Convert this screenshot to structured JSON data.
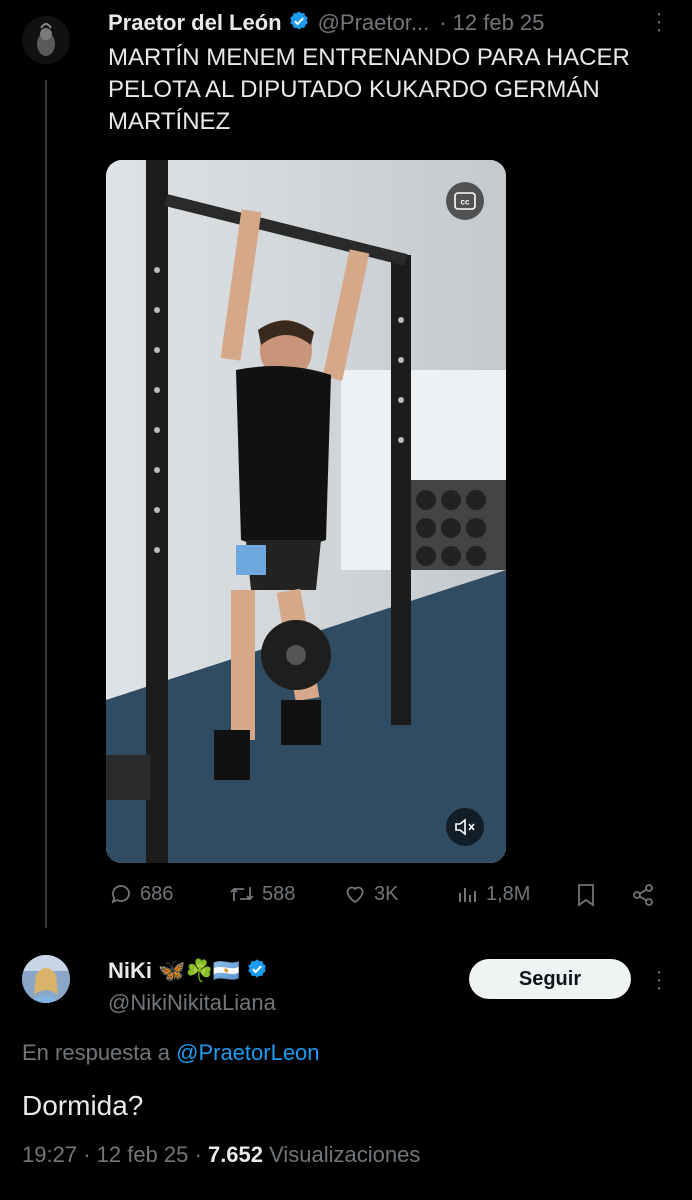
{
  "main_tweet": {
    "author_name": "Praetor del León",
    "handle": "@Praetor...",
    "date": "· 12 feb 25",
    "text": "MARTÍN MENEM ENTRENANDO PARA HACER PELOTA AL DIPUTADO KUKARDO GERMÁN MARTÍNEZ",
    "actions": {
      "replies": "686",
      "retweets": "588",
      "likes": "3K",
      "views": "1,8M"
    }
  },
  "reply": {
    "author_name": "NiKi 🦋☘️🇦🇷",
    "handle": "@NikiNikitaLiana",
    "follow_label": "Seguir",
    "reply_to_prefix": "En respuesta a",
    "reply_to_handle": "@PraetorLeon",
    "text": "Dormida?",
    "time": "19:27",
    "date": "· 12 feb 25 ·",
    "views_count": "7.652",
    "views_label": "Visualizaciones"
  },
  "colors": {
    "background": "#000000",
    "text": "#e7e9ea",
    "muted": "#71767b",
    "accent": "#1d9bf0"
  }
}
